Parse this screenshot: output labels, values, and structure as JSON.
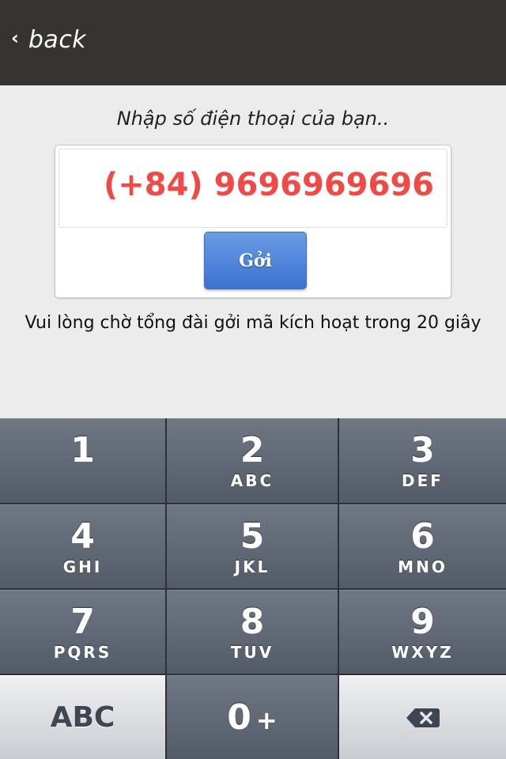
{
  "nav": {
    "back_label": "back",
    "back_icon": "chevron-left-icon"
  },
  "form": {
    "prompt": "Nhập số điện thoại của bạn..",
    "phone_value": "(+84) 9696969696",
    "phone_color": "#f04a46",
    "send_label": "Gởi",
    "notice": "Vui lòng chờ tổng đài gởi mã kích hoạt trong 20 giây"
  },
  "keypad": {
    "keys": [
      {
        "digit": "1",
        "letters": ""
      },
      {
        "digit": "2",
        "letters": "ABC"
      },
      {
        "digit": "3",
        "letters": "DEF"
      },
      {
        "digit": "4",
        "letters": "GHI"
      },
      {
        "digit": "5",
        "letters": "JKL"
      },
      {
        "digit": "6",
        "letters": "MNO"
      },
      {
        "digit": "7",
        "letters": "PQRS"
      },
      {
        "digit": "8",
        "letters": "TUV"
      },
      {
        "digit": "9",
        "letters": "WXYZ"
      }
    ],
    "abc_label": "ABC",
    "zero_digit": "0",
    "zero_plus": "+",
    "backspace_icon": "backspace-icon"
  }
}
